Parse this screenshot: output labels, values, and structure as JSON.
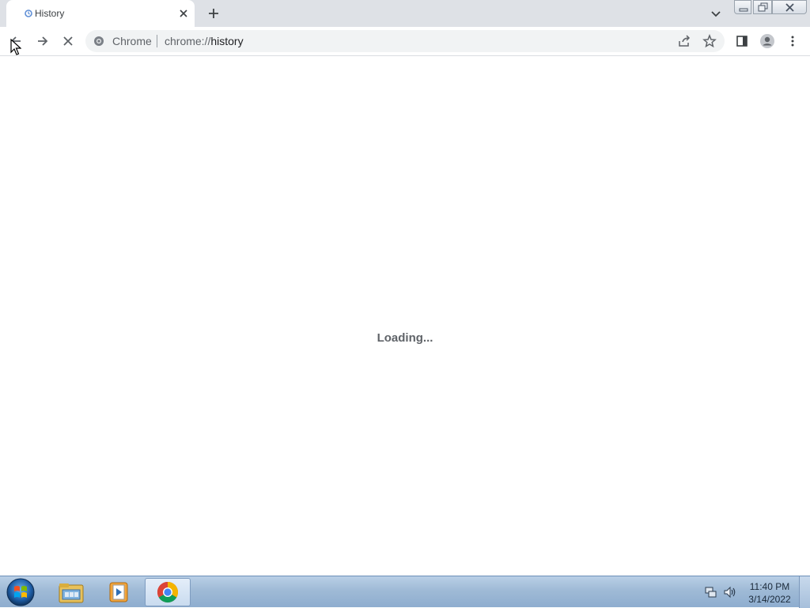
{
  "browser": {
    "tab": {
      "title": "History",
      "favicon": "history-icon"
    },
    "new_tab_icon": "plus-icon",
    "tab_search_icon": "chevron-down-icon",
    "window_controls": [
      "minimize-icon",
      "restore-icon",
      "close-icon"
    ],
    "toolbar": {
      "back_icon": "arrow-left-icon",
      "forward_icon": "arrow-right-icon",
      "stop_icon": "close-icon"
    },
    "omnibox": {
      "site_chip": "Chrome",
      "url_scheme": "chrome://",
      "url_path": "history",
      "share_icon": "share-icon",
      "bookmark_icon": "star-icon"
    },
    "side_panel_icon": "side-panel-icon",
    "profile_icon": "profile-icon",
    "menu_icon": "kebab-menu-icon"
  },
  "content": {
    "status_text": "Loading..."
  },
  "taskbar": {
    "start_icon": "windows-start-icon",
    "pinned_apps": [
      "file-explorer-icon",
      "media-player-icon",
      "chrome-icon"
    ],
    "active_app": "chrome-icon",
    "tray": {
      "network_icon": "network-icon",
      "volume_icon": "volume-icon"
    },
    "clock": {
      "time": "11:40 PM",
      "date": "3/14/2022"
    }
  },
  "colors": {
    "tabstrip": "#dee1e6",
    "omnibox": "#f1f3f4",
    "loading_text": "#5f6368",
    "taskbar": "#9fbad6"
  }
}
